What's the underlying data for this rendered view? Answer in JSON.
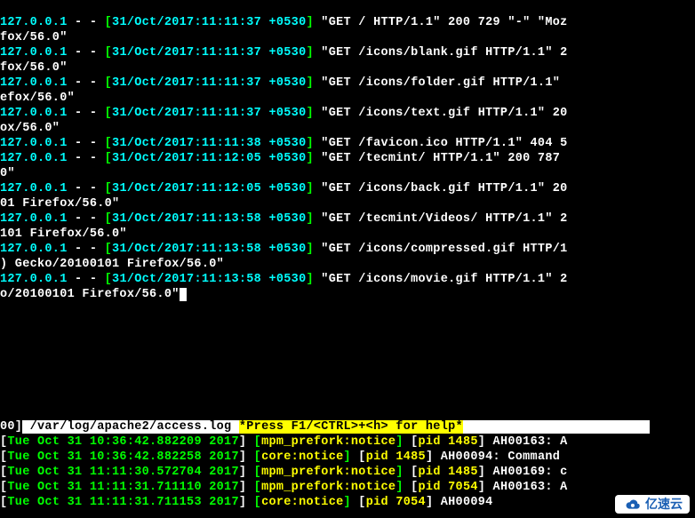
{
  "log_lines": [
    {
      "ip": "127.0.0.1",
      "sep": " - - ",
      "ts": "31/Oct/2017:11:11:37 +0530",
      "req": " \"GET / HTTP/1.1\" 200 729 \"-\" \"Moz",
      "wrap": "fox/56.0\""
    },
    {
      "ip": "127.0.0.1",
      "sep": " - - ",
      "ts": "31/Oct/2017:11:11:37 +0530",
      "req": " \"GET /icons/blank.gif HTTP/1.1\" 2",
      "wrap": "fox/56.0\""
    },
    {
      "ip": "127.0.0.1",
      "sep": " - - ",
      "ts": "31/Oct/2017:11:11:37 +0530",
      "req": " \"GET /icons/folder.gif HTTP/1.1\" ",
      "wrap": "efox/56.0\""
    },
    {
      "ip": "127.0.0.1",
      "sep": " - - ",
      "ts": "31/Oct/2017:11:11:37 +0530",
      "req": " \"GET /icons/text.gif HTTP/1.1\" 20",
      "wrap": "ox/56.0\""
    },
    {
      "ip": "127.0.0.1",
      "sep": " - - ",
      "ts": "31/Oct/2017:11:11:38 +0530",
      "req": " \"GET /favicon.ico HTTP/1.1\" 404 5",
      "wrap": ""
    },
    {
      "ip": "127.0.0.1",
      "sep": " - - ",
      "ts": "31/Oct/2017:11:12:05 +0530",
      "req": " \"GET /tecmint/ HTTP/1.1\" 200 787 ",
      "wrap": "0\""
    },
    {
      "ip": "127.0.0.1",
      "sep": " - - ",
      "ts": "31/Oct/2017:11:12:05 +0530",
      "req": " \"GET /icons/back.gif HTTP/1.1\" 20",
      "wrap": "01 Firefox/56.0\""
    },
    {
      "ip": "127.0.0.1",
      "sep": " - - ",
      "ts": "31/Oct/2017:11:13:58 +0530",
      "req": " \"GET /tecmint/Videos/ HTTP/1.1\" 2",
      "wrap": "101 Firefox/56.0\""
    },
    {
      "ip": "127.0.0.1",
      "sep": " - - ",
      "ts": "31/Oct/2017:11:13:58 +0530",
      "req": " \"GET /icons/compressed.gif HTTP/1",
      "wrap": ") Gecko/20100101 Firefox/56.0\""
    },
    {
      "ip": "127.0.0.1",
      "sep": " - - ",
      "ts": "31/Oct/2017:11:13:58 +0530",
      "req": " \"GET /icons/movie.gif HTTP/1.1\" 2",
      "wrap": "o/20100101 Firefox/56.0\""
    }
  ],
  "status": {
    "counter": "00]",
    "path": " /var/log/apache2/access.log ",
    "help": "*Press F1/<CTRL>+<h> for help*",
    "rest": "                         "
  },
  "sys_lines": [
    {
      "t": "Tue Oct 31 10:36:42.882209 2017",
      "m": "mpm_prefork:notice",
      "p": "pid 1485",
      "code": " AH00163: A"
    },
    {
      "t": "Tue Oct 31 10:36:42.882258 2017",
      "m": "core:notice",
      "p": "pid 1485",
      "code": " AH00094: Command "
    },
    {
      "t": "Tue Oct 31 11:11:30.572704 2017",
      "m": "mpm_prefork:notice",
      "p": "pid 1485",
      "code": " AH00169: c"
    },
    {
      "t": "Tue Oct 31 11:11:31.711110 2017",
      "m": "mpm_prefork:notice",
      "p": "pid 7054",
      "code": " AH00163: A"
    },
    {
      "t": "Tue Oct 31 11:11:31.711153 2017",
      "m": "core:notice",
      "p": "pid 7054",
      "code": " AH00094"
    }
  ],
  "watermark": "亿速云"
}
